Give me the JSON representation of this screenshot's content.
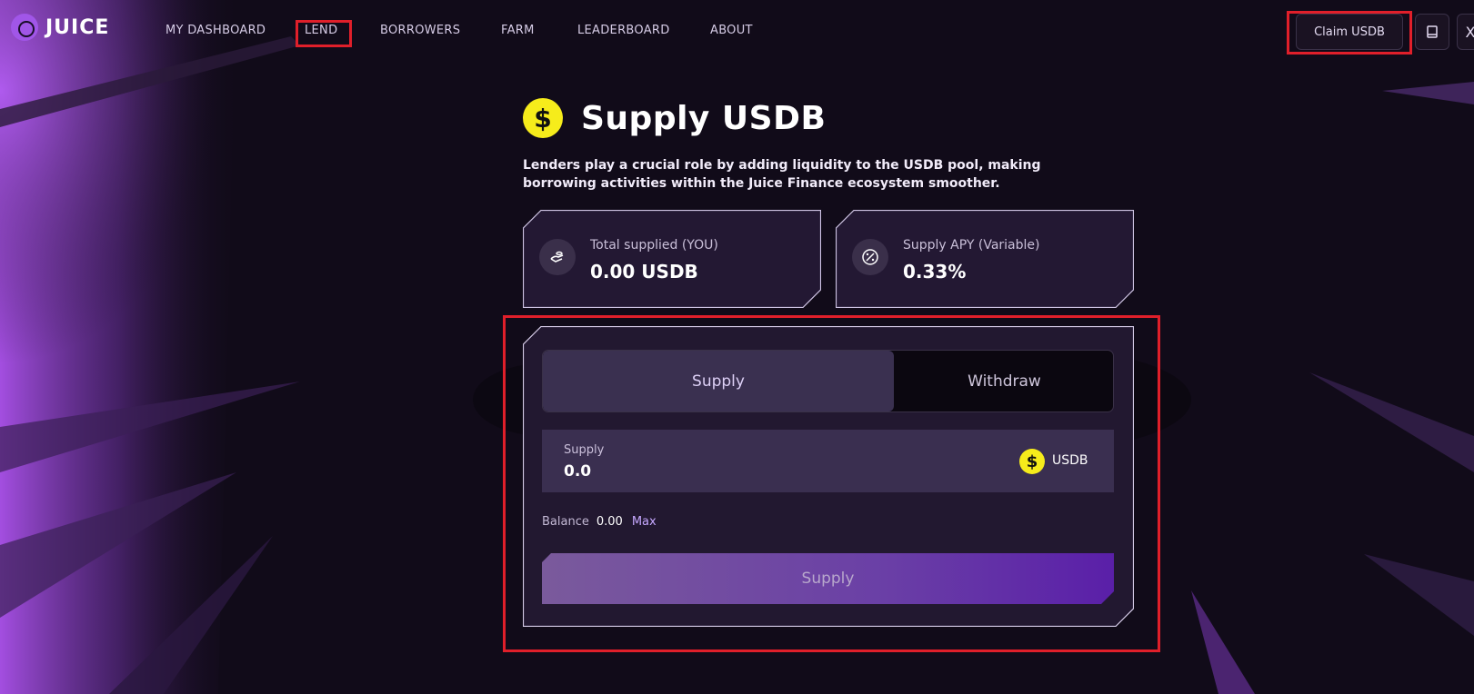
{
  "header": {
    "logo_text": "JUICE",
    "nav": [
      {
        "label": "MY DASHBOARD"
      },
      {
        "label": "LEND"
      },
      {
        "label": "BORROWERS"
      },
      {
        "label": "FARM"
      },
      {
        "label": "LEADERBOARD"
      },
      {
        "label": "ABOUT"
      }
    ],
    "claim_label": "Claim USDB",
    "book_icon": "book-icon",
    "x_icon": "x-social-icon",
    "x_glyph": "X"
  },
  "page": {
    "title": "Supply USDB",
    "description": "Lenders play a crucial role by adding liquidity to the USDB pool, making borrowing activities within the Juice Finance ecosystem smoother.",
    "coin_glyph": "$"
  },
  "stats": [
    {
      "label": "Total supplied (YOU)",
      "value": "0.00 USDB",
      "icon": "hand-coins-icon"
    },
    {
      "label": "Supply APY (Variable)",
      "value": "0.33%",
      "icon": "percent-icon"
    }
  ],
  "panel": {
    "tabs": [
      {
        "label": "Supply",
        "active": true
      },
      {
        "label": "Withdraw",
        "active": false
      }
    ],
    "field_label": "Supply",
    "field_value": "0.0",
    "token": "USDB",
    "balance_label": "Balance",
    "balance_value": "0.00",
    "max_label": "Max",
    "submit_label": "Supply"
  },
  "colors": {
    "background": "#0f0a16",
    "accent_purple": "#a156e8",
    "usdb_yellow": "#f6ec1b",
    "highlight_red": "#e01f2a"
  }
}
